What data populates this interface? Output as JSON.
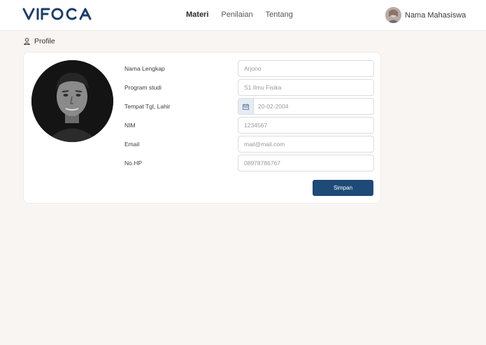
{
  "brand": {
    "logo_text": "VIFOCA",
    "logo_color": "#1e3d66"
  },
  "nav": {
    "items": [
      {
        "label": "Materi",
        "active": true
      },
      {
        "label": "Penilaian",
        "active": false
      },
      {
        "label": "Tentang",
        "active": false
      }
    ]
  },
  "user": {
    "name": "Nama Mahasiswa",
    "avatar_icon": "user-avatar"
  },
  "page": {
    "title": "Profile",
    "icon": "user-icon"
  },
  "profile_form": {
    "fields": [
      {
        "label": "Nama Lengkap",
        "value": "Arjono"
      },
      {
        "label": "Program studi",
        "value": "S1 Ilmu Fisika"
      },
      {
        "label": "Tempat Tgl, Lahir",
        "value": "20-02-2004",
        "icon": "calendar-icon"
      },
      {
        "label": "NIM",
        "value": "1234567"
      },
      {
        "label": "Email",
        "value": "mail@mail.com"
      },
      {
        "label": "No.HP",
        "value": "08978786767"
      }
    ],
    "save_label": "Simpan"
  },
  "colors": {
    "primary": "#1e4a78",
    "background": "#f8f5f3",
    "card": "#ffffff"
  }
}
